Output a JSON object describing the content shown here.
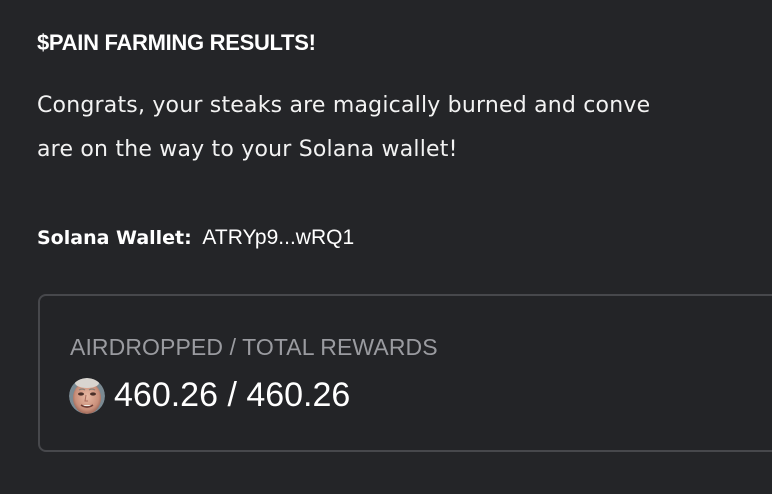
{
  "title": "$PAIN FARMING RESULTS!",
  "message": {
    "line1": "Congrats, your steaks are magically burned and conve",
    "line2": "are on the way to your Solana wallet!"
  },
  "wallet": {
    "label": "Solana Wallet:",
    "address": "ATRYp9...wRQ1"
  },
  "rewards": {
    "heading": "AIRDROPPED / TOTAL REWARDS",
    "amount": "460.26 / 460.26",
    "token_icon": "pain-token-avatar-icon"
  },
  "colors": {
    "background": "#242528",
    "card_border": "#47484c",
    "muted_text": "#9a9ba0"
  }
}
